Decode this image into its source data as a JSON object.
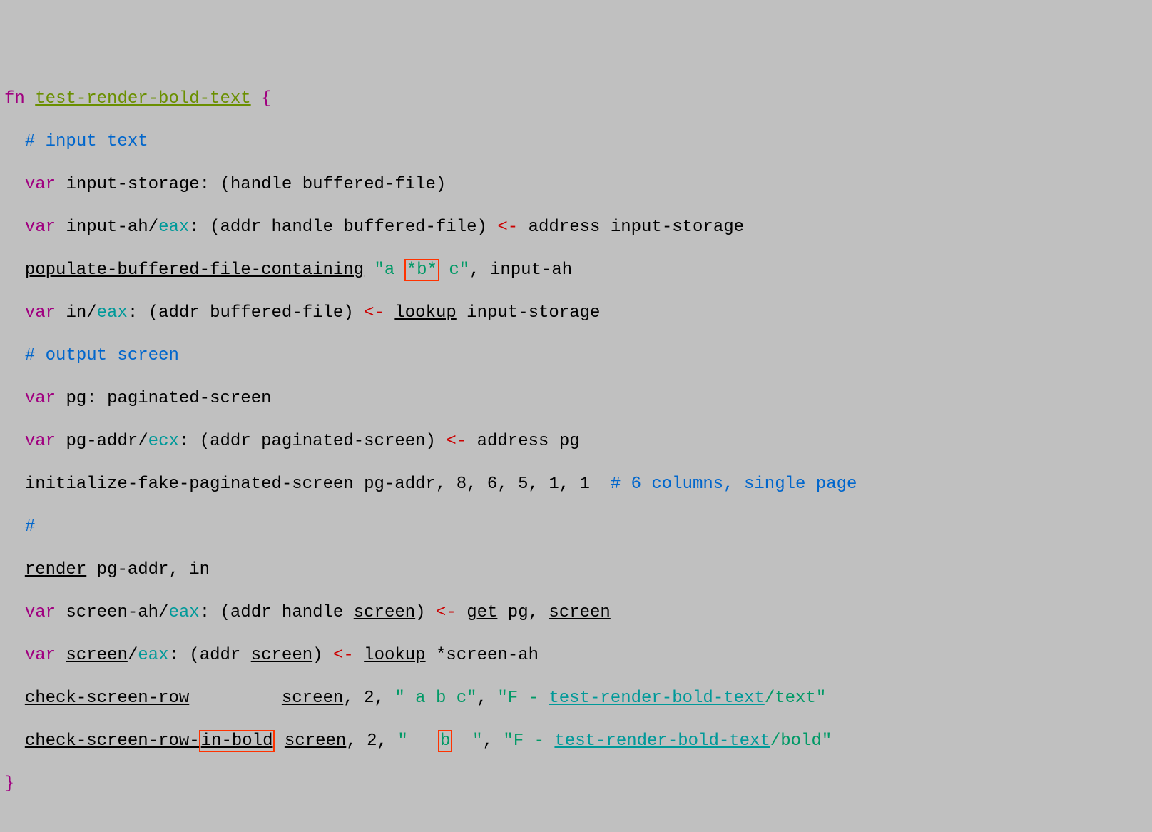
{
  "kw": {
    "fn": "fn",
    "var": "var",
    "brace_open": "{",
    "brace_close": "}"
  },
  "fn_name": "test-render-bold-text",
  "lines": {
    "l1_comment": "# input text",
    "l2": {
      "name": "input-storage:",
      "type": "(handle buffered-file)"
    },
    "l3": {
      "name": "input-ah",
      "reg": "eax",
      "type": "(addr handle buffered-file)",
      "arrow": "<-",
      "rhs": "address input-storage"
    },
    "l4": {
      "call": "populate-buffered-file-containing",
      "str_pre": "\"a ",
      "str_hl": "*b*",
      "str_post": " c\"",
      "rest": ", input-ah"
    },
    "l5": {
      "name": "in",
      "reg": "eax",
      "type": "(addr buffered-file)",
      "arrow": "<-",
      "call": "lookup",
      "rest": " input-storage"
    },
    "l6_comment": "# output screen",
    "l7": {
      "name": "pg:",
      "type": "paginated-screen"
    },
    "l8": {
      "name": "pg-addr",
      "reg": "ecx",
      "type": "(addr paginated-screen)",
      "arrow": "<-",
      "rhs": "address pg"
    },
    "l9": {
      "text": "initialize-fake-paginated-screen pg-addr, ",
      "nums": "8, 6, 5, 1, 1",
      "comment": "  # 6 columns, single page"
    },
    "l10_comment": "#",
    "l11": {
      "call": "render",
      "rest": " pg-addr, in"
    },
    "l12": {
      "name": "screen-ah",
      "reg": "eax",
      "type_pre": "(addr handle ",
      "type_link": "screen",
      "type_post": ")",
      "arrow": "<-",
      "call": "get",
      "rest_pre": " pg, ",
      "rest_link": "screen"
    },
    "l13": {
      "name": "screen",
      "reg": "eax",
      "type_pre": "(addr ",
      "type_link": "screen",
      "type_post": ")",
      "arrow": "<-",
      "call": "lookup",
      "rest": " *screen-ah"
    },
    "l14": {
      "call": "check-screen-row",
      "pad": "        ",
      "arg_link": "screen",
      "num": "2",
      "str1": "\" a b c\"",
      "str2_pre": "\"F - ",
      "str2_link": "test-render-bold-text",
      "str2_post": "/text\""
    },
    "l15": {
      "call_pre": "check-screen-row-",
      "call_hl": "in-bold",
      "arg_link": "screen",
      "num": "2",
      "str1_pre": "\"   ",
      "str1_hl": "b",
      "str1_post": "  \"",
      "str2_pre": "\"F - ",
      "str2_link": "test-render-bold-text",
      "str2_post": "/bold\""
    }
  }
}
